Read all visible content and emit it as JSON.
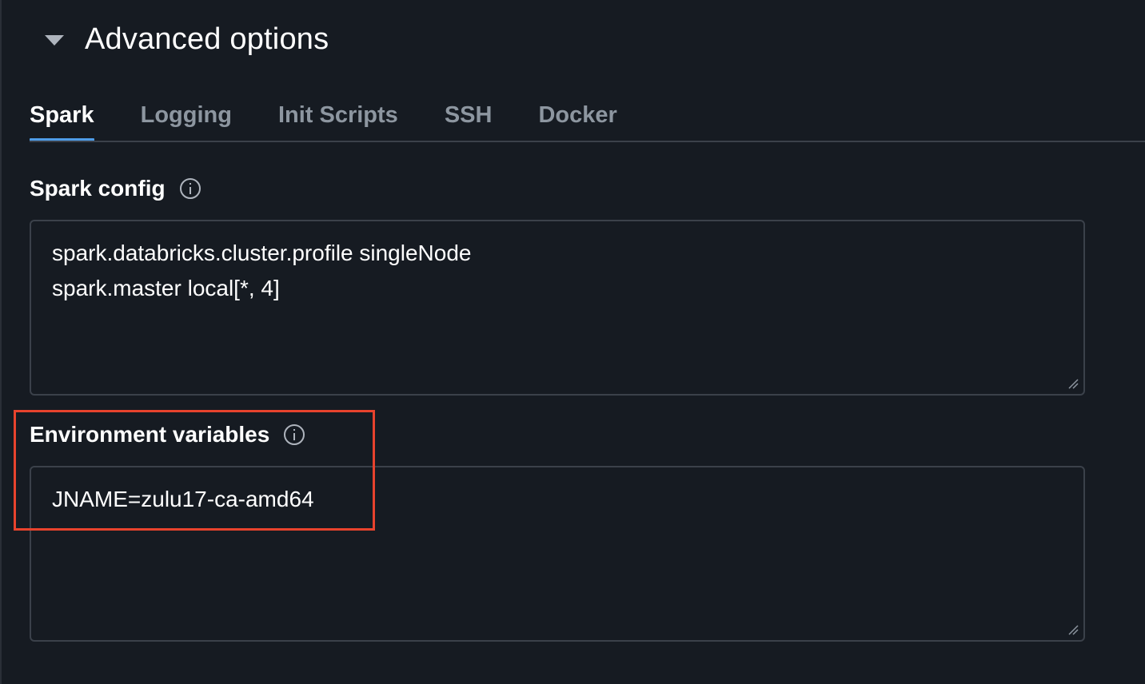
{
  "section": {
    "title": "Advanced options"
  },
  "tabs": [
    {
      "label": "Spark",
      "active": true
    },
    {
      "label": "Logging",
      "active": false
    },
    {
      "label": "Init Scripts",
      "active": false
    },
    {
      "label": "SSH",
      "active": false
    },
    {
      "label": "Docker",
      "active": false
    }
  ],
  "spark_config": {
    "label": "Spark config",
    "lines": [
      "spark.databricks.cluster.profile singleNode",
      "spark.master local[*, 4]"
    ]
  },
  "env_vars": {
    "label": "Environment variables",
    "lines": [
      "JNAME=zulu17-ca-amd64"
    ]
  },
  "colors": {
    "background": "#161b22",
    "active_tab_underline": "#4f9de8",
    "highlight_box": "#e8432d",
    "inactive_tab_text": "#8d96a0"
  }
}
